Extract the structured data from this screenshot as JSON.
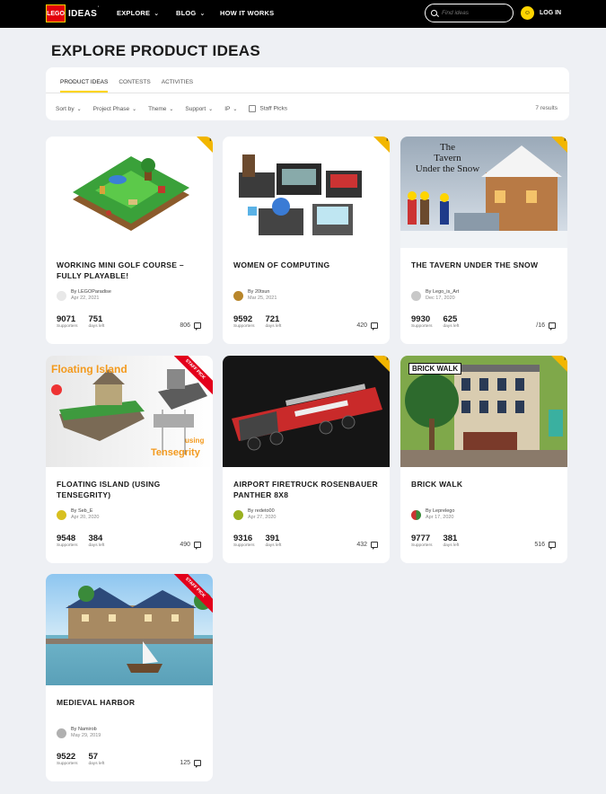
{
  "header": {
    "logo_badge": "LEGO",
    "logo_text": "IDEAS",
    "logo_sup": "'",
    "nav": [
      {
        "label": "EXPLORE",
        "chevron": "⌄"
      },
      {
        "label": "BLOG",
        "chevron": "⌄"
      },
      {
        "label": "HOW IT WORKS",
        "chevron": ""
      }
    ],
    "search_placeholder": "Find ideas",
    "login_label": "LOG IN",
    "login_icon": "☺",
    "colors": {
      "bar": "#000000",
      "accent": "#ffd500",
      "brand_red": "#e3000b"
    }
  },
  "page_title": "EXPLORE PRODUCT IDEAS",
  "tabs": [
    "PRODUCT IDEAS",
    "CONTESTS",
    "ACTIVITIES"
  ],
  "filters": [
    "Sort by",
    "Project Phase",
    "Theme",
    "Support",
    "IP"
  ],
  "staff_picks_label": "Staff Picks",
  "results_text": "7 results",
  "supporters_label": "Supporters",
  "days_left_label": "days left",
  "staff_pick_badge": "STAFF PICK",
  "cards": [
    {
      "title": "WORKING MINI GOLF COURSE – FULLY PLAYABLE!",
      "author": "By LEGOParadise",
      "date": "Apr 22, 2021",
      "supporters": "9071",
      "days": "751",
      "comments": "806",
      "staff_pick": false
    },
    {
      "title": "WOMEN OF COMPUTING",
      "author": "By 20tsun",
      "date": "Mar 25, 2021",
      "supporters": "9592",
      "days": "721",
      "comments": "420",
      "staff_pick": false
    },
    {
      "title": "THE TAVERN UNDER THE SNOW",
      "author": "By Lego_is_Art",
      "date": "Dec 17, 2020",
      "supporters": "9930",
      "days": "625",
      "comments": "/16",
      "staff_pick": false,
      "image_text": [
        "The",
        "Tavern",
        "Under the Snow"
      ]
    },
    {
      "title": "FLOATING ISLAND (USING TENSEGRITY)",
      "author": "By Seb_E",
      "date": "Apr 20, 2020",
      "supporters": "9548",
      "days": "384",
      "comments": "490",
      "staff_pick": true,
      "image_text": [
        "Floating Island",
        "using",
        "Tensegrity"
      ]
    },
    {
      "title": "AIRPORT FIRETRUCK ROSENBAUER PANTHER 8X8",
      "author": "By redeto00",
      "date": "Apr 27, 2020",
      "supporters": "9316",
      "days": "391",
      "comments": "432",
      "staff_pick": false
    },
    {
      "title": "BRICK WALK",
      "author": "By Leprelego",
      "date": "Apr 17, 2020",
      "supporters": "9777",
      "days": "381",
      "comments": "516",
      "staff_pick": false,
      "image_text": [
        "BRICK WALK"
      ]
    },
    {
      "title": "MEDIEVAL HARBOR",
      "author": "By Namirob",
      "date": "May 29, 2019",
      "supporters": "9522",
      "days": "57",
      "comments": "125",
      "staff_pick": true
    }
  ]
}
